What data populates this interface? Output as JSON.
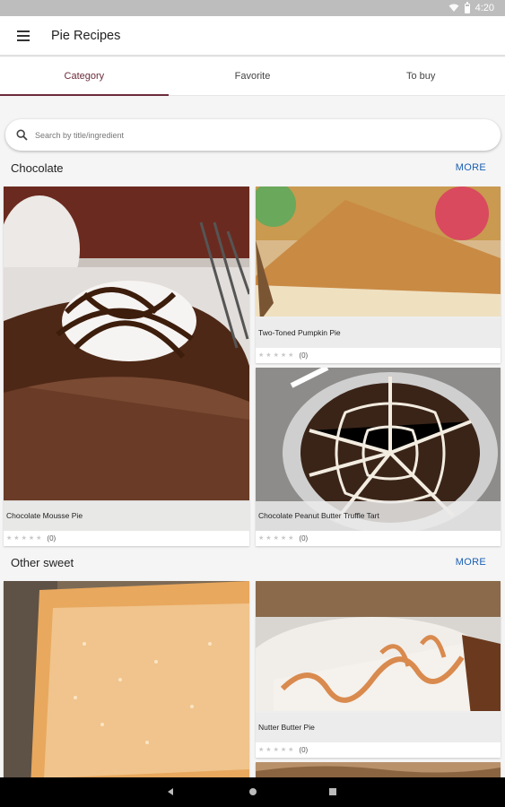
{
  "status_bar": {
    "time": "4:20"
  },
  "app_bar": {
    "title": "Pie Recipes"
  },
  "tabs": [
    {
      "label": "Category",
      "active": true
    },
    {
      "label": "Favorite",
      "active": false
    },
    {
      "label": "To buy",
      "active": false
    }
  ],
  "search": {
    "placeholder": "Search by title/ingredient"
  },
  "sections": [
    {
      "title": "Chocolate",
      "more_label": "MORE",
      "recipes": [
        {
          "title": "Chocolate Mousse Pie",
          "rating_count": "(0)"
        },
        {
          "title": "Two-Toned Pumpkin Pie",
          "rating_count": "(0)"
        },
        {
          "title": "Chocolate Peanut Butter Truffle Tart",
          "rating_count": "(0)"
        }
      ]
    },
    {
      "title": "Other sweet",
      "more_label": "MORE",
      "recipes": [
        {
          "title": "",
          "rating_count": ""
        },
        {
          "title": "Nutter Butter Pie",
          "rating_count": "(0)"
        }
      ]
    }
  ],
  "colors": {
    "accent": "#6b2c3a",
    "link": "#1a5fb4"
  }
}
